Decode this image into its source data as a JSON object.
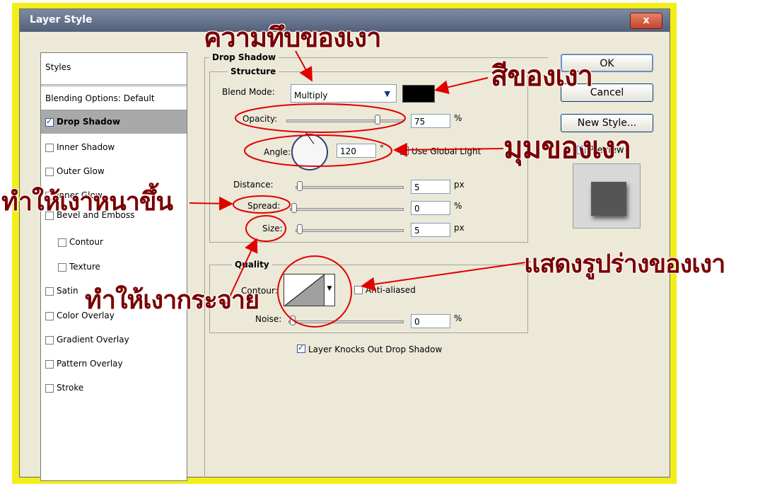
{
  "dialog": {
    "title": "Layer Style",
    "close_label": "x"
  },
  "styles_panel": {
    "header": "Styles",
    "blending": "Blending Options: Default",
    "items": [
      {
        "label": "Drop Shadow",
        "checked": true,
        "selected": true
      },
      {
        "label": "Inner Shadow",
        "checked": false
      },
      {
        "label": "Outer Glow",
        "checked": false
      },
      {
        "label": "Inner Glow",
        "checked": false
      },
      {
        "label": "Bevel and Emboss",
        "checked": false
      },
      {
        "label": "Contour",
        "checked": false
      },
      {
        "label": "Texture",
        "checked": false
      },
      {
        "label": "Satin",
        "checked": false
      },
      {
        "label": "Color Overlay",
        "checked": false
      },
      {
        "label": "Gradient Overlay",
        "checked": false
      },
      {
        "label": "Pattern Overlay",
        "checked": false
      },
      {
        "label": "Stroke",
        "checked": false
      }
    ]
  },
  "drop_shadow": {
    "title": "Drop Shadow",
    "structure": {
      "title": "Structure",
      "blend_mode_label": "Blend Mode:",
      "blend_mode_value": "Multiply",
      "shadow_color": "#000000",
      "opacity_label": "Opacity:",
      "opacity_value": "75",
      "opacity_unit": "%",
      "angle_label": "Angle:",
      "angle_value": "120",
      "angle_unit": "°",
      "use_global_light_label": "Use Global Light",
      "use_global_light": true,
      "distance_label": "Distance:",
      "distance_value": "5",
      "distance_unit": "px",
      "spread_label": "Spread:",
      "spread_value": "0",
      "spread_unit": "%",
      "size_label": "Size:",
      "size_value": "5",
      "size_unit": "px"
    },
    "quality": {
      "title": "Quality",
      "contour_label": "Contour:",
      "anti_aliased_label": "Anti-aliased",
      "noise_label": "Noise:",
      "noise_value": "0",
      "noise_unit": "%"
    },
    "knocks_out_label": "Layer Knocks Out Drop Shadow",
    "knocks_out": true
  },
  "buttons": {
    "ok": "OK",
    "cancel": "Cancel",
    "new_style": "New Style...",
    "preview": "Preview",
    "preview_checked": true
  },
  "annotations": {
    "opacity": "ความทึบของเงา",
    "color": "สีของเงา",
    "angle": "มุมของเงา",
    "spread": "ทำให้เงาหนาขึ้น",
    "contour": "แสดงรูปร่างของเงา",
    "size": "ทำให้เงากระจาย"
  },
  "colors": {
    "frame": "#f2ee1a",
    "annotation_text": "#7a0000",
    "arrow": "#e00000"
  }
}
